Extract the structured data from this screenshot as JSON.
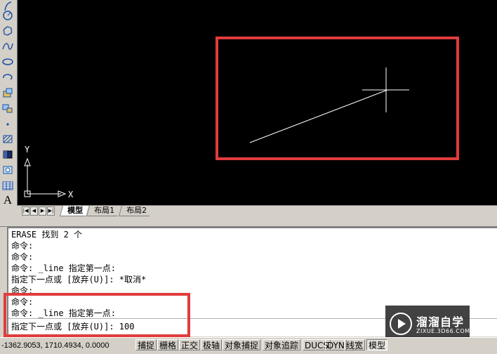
{
  "toolbar": {
    "tools": [
      {
        "name": "arc-icon"
      },
      {
        "name": "circle-icon"
      },
      {
        "name": "revision-cloud-icon"
      },
      {
        "name": "spline-icon"
      },
      {
        "name": "ellipse-icon"
      },
      {
        "name": "ellipse-arc-icon"
      },
      {
        "name": "insert-block-icon"
      },
      {
        "name": "make-block-icon"
      },
      {
        "name": "point-icon"
      },
      {
        "name": "hatch-icon"
      },
      {
        "name": "gradient-icon"
      },
      {
        "name": "region-icon"
      },
      {
        "name": "table-icon"
      },
      {
        "name": "multiline-text-icon",
        "glyph": "A"
      }
    ]
  },
  "canvas": {
    "background": "#000000",
    "ucs_x_label": "X",
    "ucs_y_label": "Y"
  },
  "tabs": {
    "items": [
      {
        "label": "模型",
        "active": true
      },
      {
        "label": "布局1",
        "active": false
      },
      {
        "label": "布局2",
        "active": false
      }
    ]
  },
  "command_window": {
    "lines": [
      "ERASE 找到 2 个",
      "命令:",
      "命令:",
      "命令: _line 指定第一点:",
      "指定下一点或 [放弃(U)]: *取消*",
      "命令:",
      "命令:",
      "命令: _line 指定第一点:"
    ],
    "input": "指定下一点或 [放弃(U)]: 100"
  },
  "highlight_color": "#e03c3c",
  "watermark": {
    "title": "溜溜自学",
    "subtitle": "ZIXUE.3D66.COM"
  },
  "status_bar": {
    "coordinates": "-1362.9053, 1710.4934, 0.0000",
    "buttons": [
      {
        "label": "捕捉",
        "on": false
      },
      {
        "label": "栅格",
        "on": false
      },
      {
        "label": "正交",
        "on": false
      },
      {
        "label": "极轴",
        "on": false
      },
      {
        "label": "对象捕捉",
        "on": false
      },
      {
        "label": "对象追踪",
        "on": false
      },
      {
        "label": "DUCS",
        "on": false
      },
      {
        "label": "DYN",
        "on": false
      },
      {
        "label": "线宽",
        "on": false
      },
      {
        "label": "模型",
        "on": true
      }
    ]
  }
}
